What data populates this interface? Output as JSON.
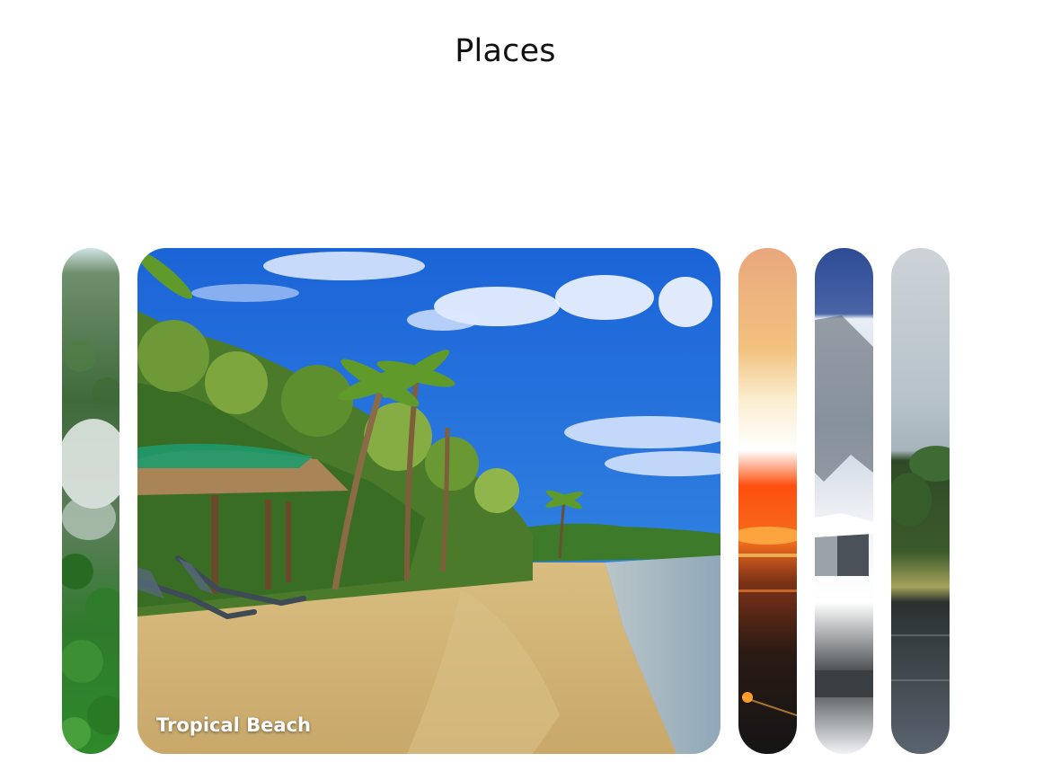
{
  "header": {
    "title": "Places"
  },
  "panels": [
    {
      "id": "forest",
      "label": "",
      "state": "collapsed"
    },
    {
      "id": "beach",
      "label": "Tropical Beach",
      "state": "expanded"
    },
    {
      "id": "sunset",
      "label": "",
      "state": "collapsed"
    },
    {
      "id": "snow",
      "label": "",
      "state": "collapsed"
    },
    {
      "id": "lake",
      "label": "",
      "state": "collapsed"
    }
  ],
  "colors": {
    "background": "#ffffff",
    "title": "#111111",
    "caption": "#ffffff"
  }
}
